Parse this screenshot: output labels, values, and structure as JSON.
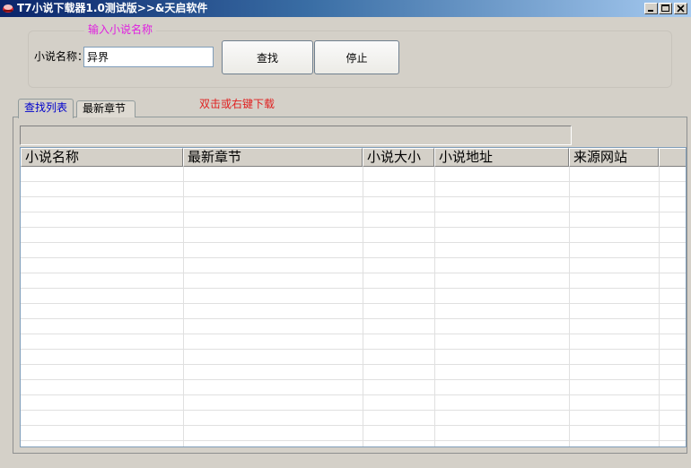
{
  "window": {
    "title": "T7小说下载器1.0测试版>>&天启软件"
  },
  "search": {
    "group_title": "输入小说名称",
    "field_label": "小说名称：",
    "field_value": "异界",
    "find_button": "查找",
    "stop_button": "停止"
  },
  "tabs": [
    {
      "label": "查找列表",
      "active": true
    },
    {
      "label": "最新章节",
      "active": false
    }
  ],
  "hint": "双击或右键下载",
  "table": {
    "columns": [
      "小说名称",
      "最新章节",
      "小说大小",
      "小说地址",
      "来源网站"
    ],
    "rows": []
  },
  "colors": {
    "title_gradient_start": "#0a246a",
    "legend": "#e020e0",
    "hint": "#e02020",
    "active_tab": "#0000cc"
  }
}
